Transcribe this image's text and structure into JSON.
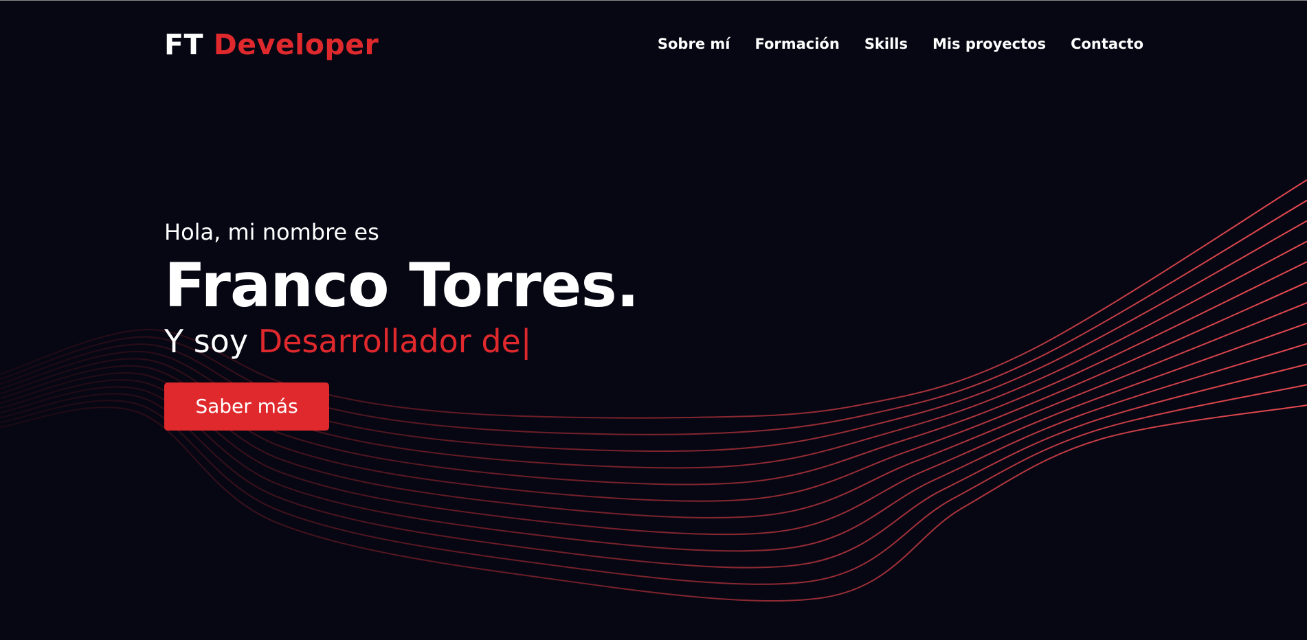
{
  "brand": {
    "prefix": "FT",
    "name": "Developer",
    "accent_color": "#e0292d"
  },
  "nav": {
    "items": [
      {
        "label": "Sobre mí"
      },
      {
        "label": "Formación"
      },
      {
        "label": "Skills"
      },
      {
        "label": "Mis proyectos"
      },
      {
        "label": "Contacto"
      }
    ]
  },
  "hero": {
    "greeting": "Hola, mi nombre es",
    "name": "Franco Torres.",
    "subtitle_prefix": "Y soy",
    "role_text": "Desarrollador de|",
    "cta_label": "Saber más"
  },
  "theme": {
    "background": "#070714",
    "accent": "#e0292d",
    "text": "#ffffff"
  }
}
